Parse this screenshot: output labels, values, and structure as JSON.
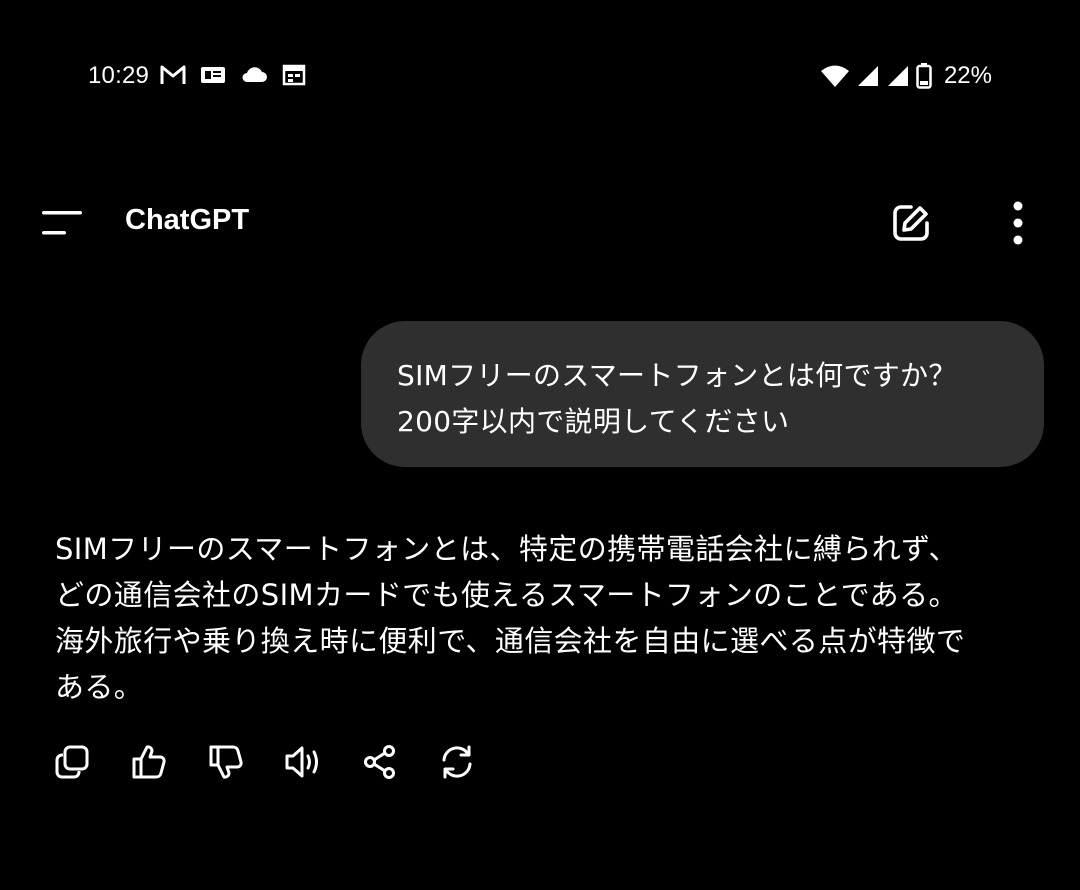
{
  "status_bar": {
    "time": "10:29",
    "left_icons": [
      "gmail-icon",
      "messages-icon",
      "cloud-icon",
      "calendar-icon"
    ],
    "right_icons": [
      "wifi-icon",
      "signal-icon",
      "signal-icon",
      "battery-icon"
    ],
    "battery": "22%"
  },
  "app_bar": {
    "title": "ChatGPT"
  },
  "conversation": {
    "user_message": {
      "lines": [
        "SIMフリーのスマートフォンとは何ですか？",
        "200字以内で説明してください"
      ]
    },
    "assistant_message": {
      "lines": [
        "SIMフリーのスマートフォンとは、特定の携帯電話会社に縛られず、",
        "どの通信会社のSIMカードでも使えるスマートフォンのことである。",
        "海外旅行や乗り換え時に便利で、通信会社を自由に選べる点が特徴で",
        "ある。"
      ]
    }
  },
  "actions": [
    "copy-icon",
    "thumbs-up-icon",
    "thumbs-down-icon",
    "read-aloud-icon",
    "share-icon",
    "regenerate-icon"
  ],
  "colors": {
    "background": "#000000",
    "bubble": "#2f2f2f",
    "text": "#ffffff"
  }
}
